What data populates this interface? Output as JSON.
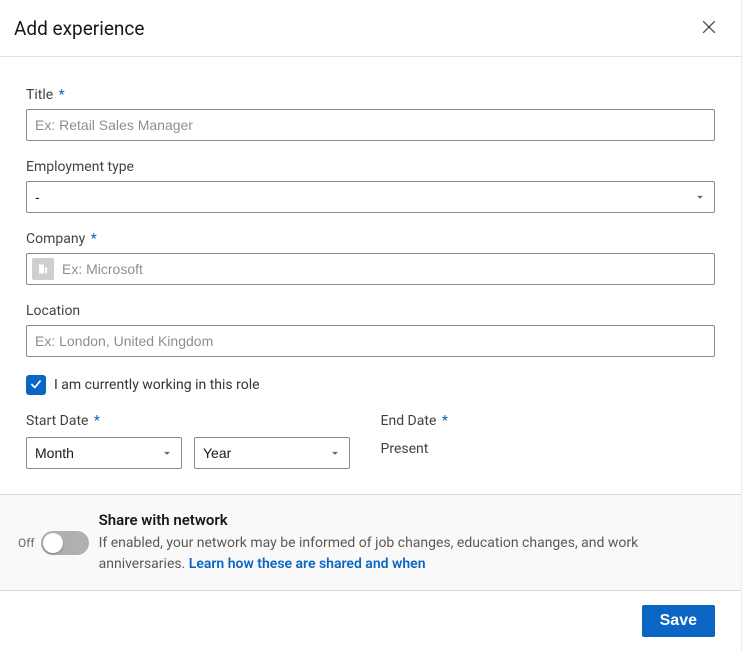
{
  "header": {
    "title": "Add experience"
  },
  "fields": {
    "title": {
      "label": "Title",
      "required": true,
      "placeholder": "Ex: Retail Sales Manager",
      "value": ""
    },
    "employment_type": {
      "label": "Employment type",
      "required": false,
      "value": "-"
    },
    "company": {
      "label": "Company",
      "required": true,
      "placeholder": "Ex: Microsoft",
      "value": ""
    },
    "location": {
      "label": "Location",
      "required": false,
      "placeholder": "Ex: London, United Kingdom",
      "value": ""
    },
    "currently_working": {
      "label": "I am currently working in this role",
      "checked": true
    },
    "start_date": {
      "label": "Start Date",
      "required": true,
      "month": "Month",
      "year": "Year"
    },
    "end_date": {
      "label": "End Date",
      "required": true,
      "value": "Present"
    }
  },
  "share": {
    "title": "Share with network",
    "state": "Off",
    "description_prefix": "If enabled, your network may be informed of job changes, education changes, and work anniversaries. ",
    "link_text": "Learn how these are shared and when"
  },
  "footer": {
    "save": "Save"
  }
}
